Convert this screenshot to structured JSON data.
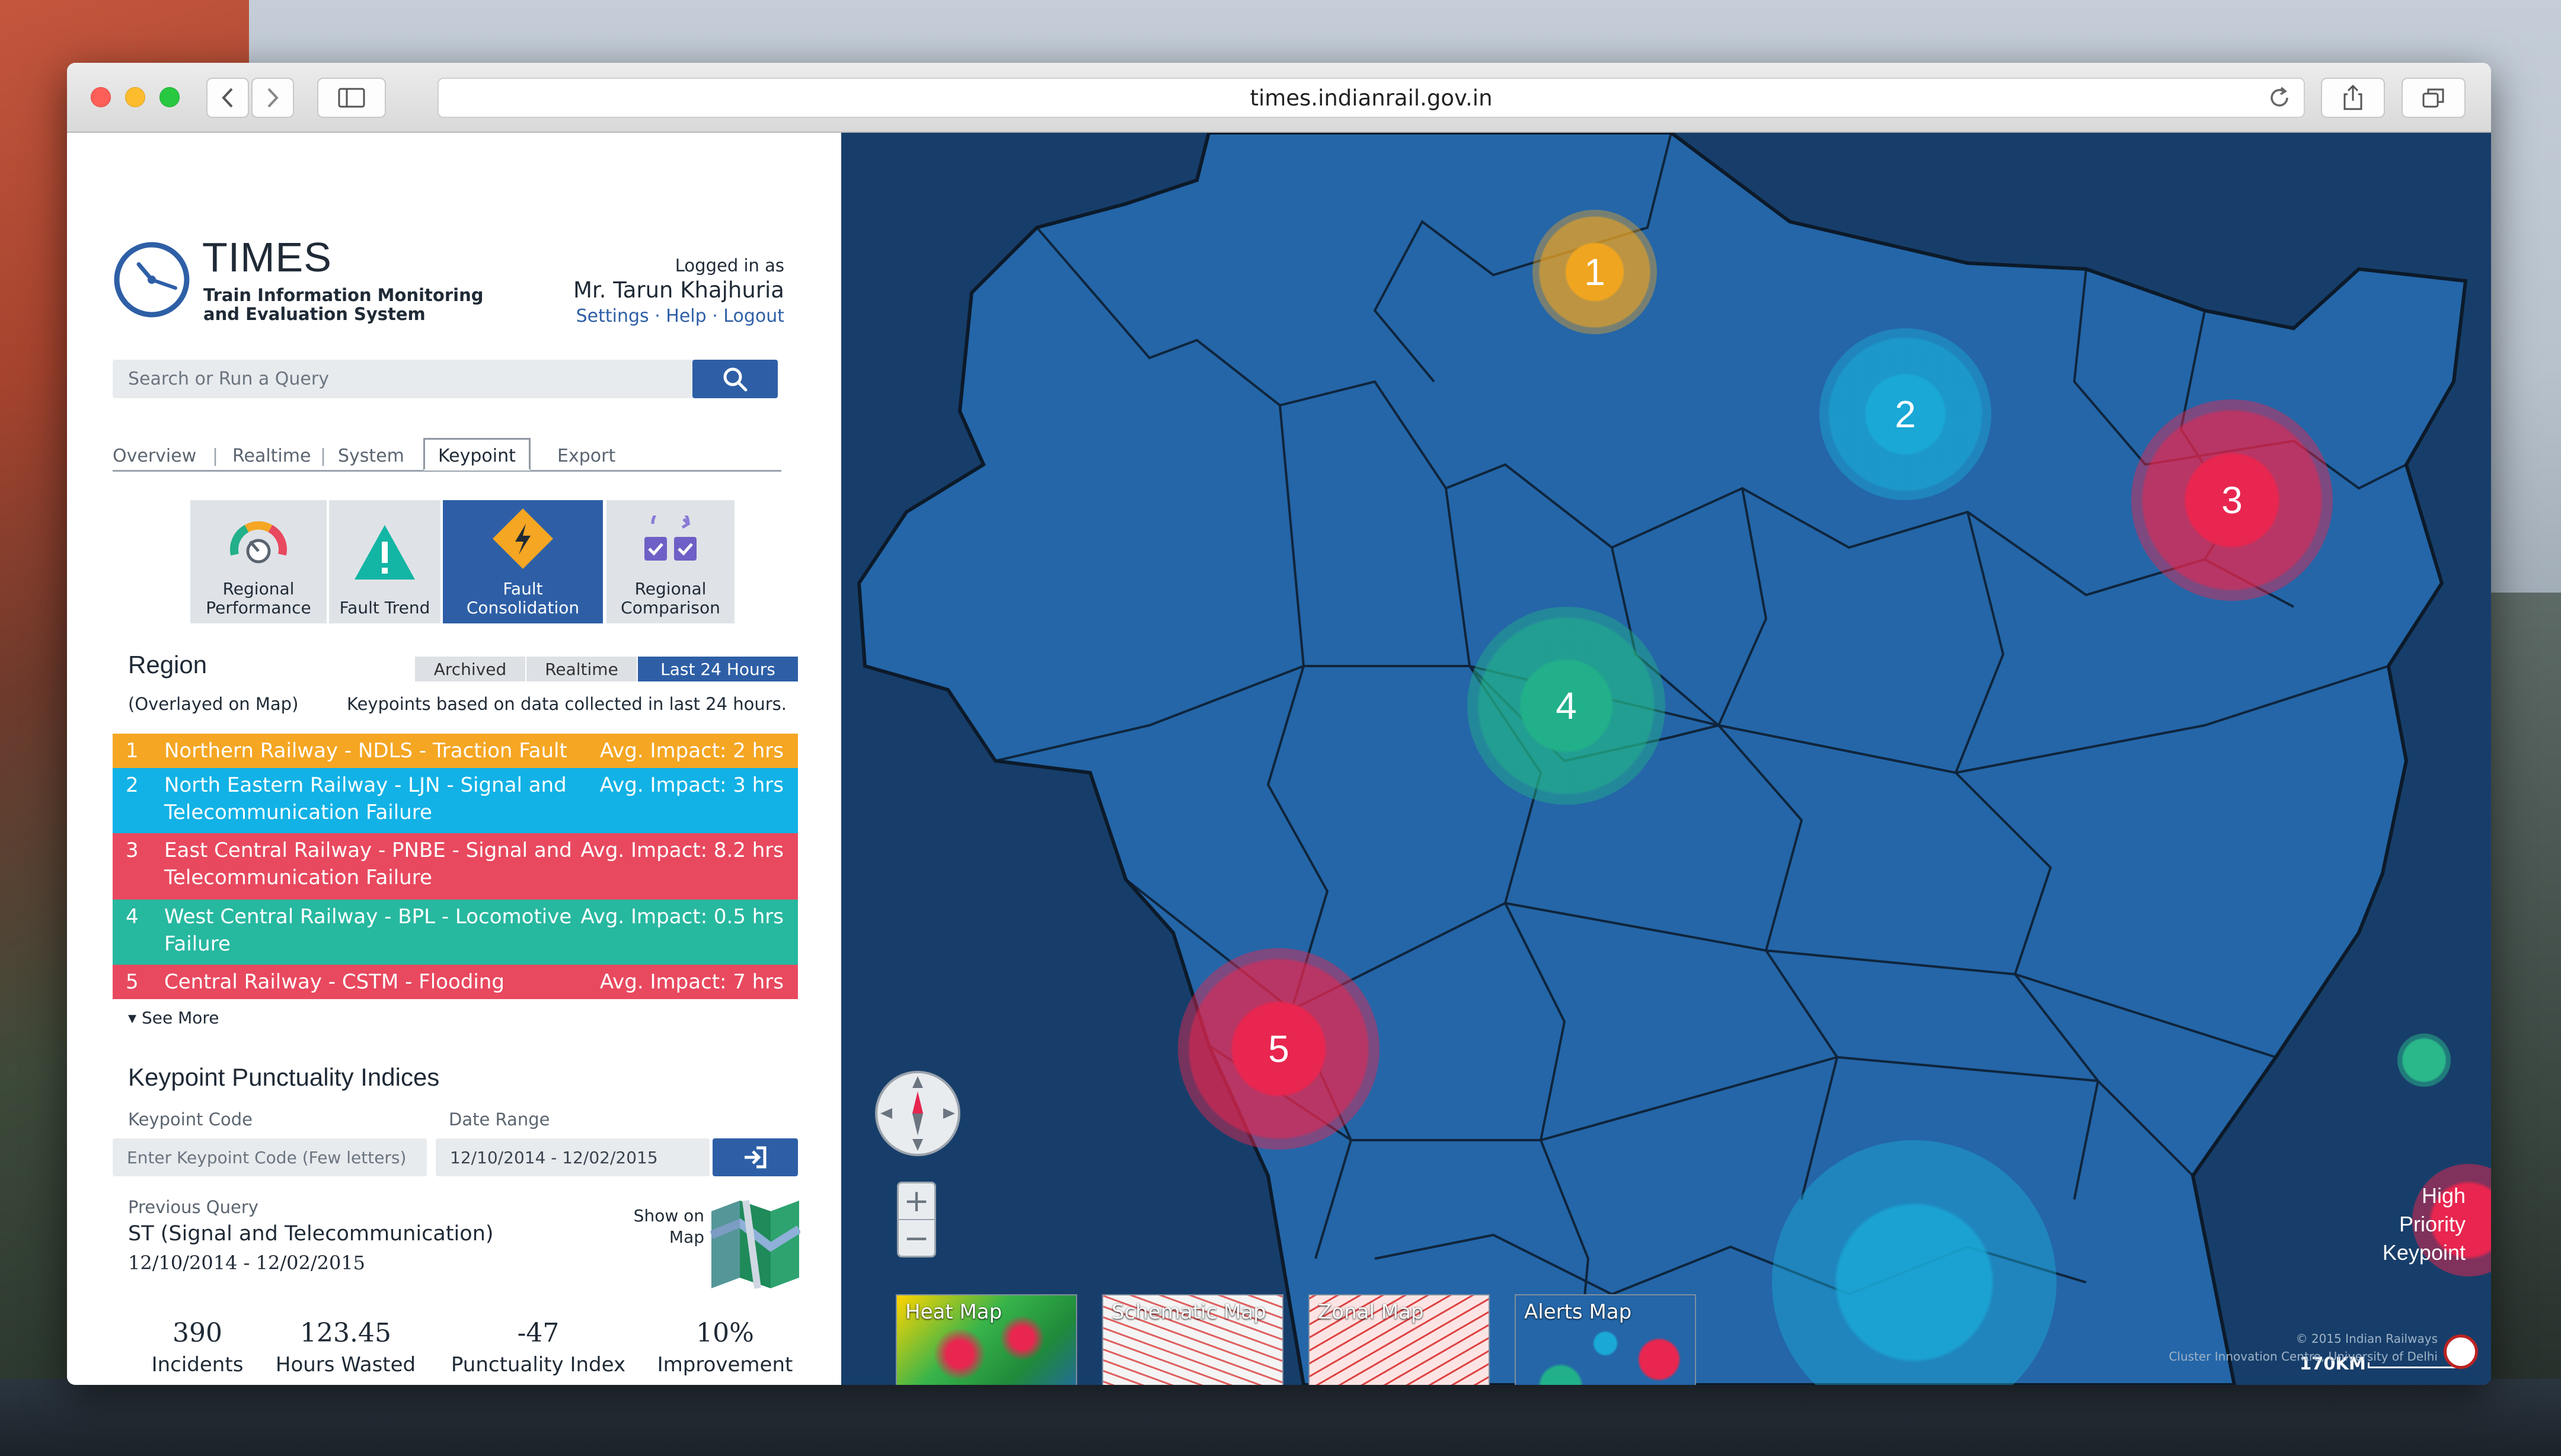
{
  "browser": {
    "url": "times.indianrail.gov.in"
  },
  "app": {
    "name": "TIMES",
    "subtitle_line1": "Train Information Monitoring",
    "subtitle_line2": "and Evaluation System",
    "logged_in_label": "Logged in as",
    "user": "Mr. Tarun Khajhuria",
    "links": [
      "Settings",
      "Help",
      "Logout"
    ]
  },
  "search": {
    "placeholder": "Search or Run a Query"
  },
  "tabs": [
    {
      "label": "Overview"
    },
    {
      "label": "Realtime"
    },
    {
      "label": "System"
    },
    {
      "label": "Keypoint",
      "selected": true
    },
    {
      "label": "Export"
    }
  ],
  "tiles": [
    {
      "label": "Regional\nPerformance",
      "icon": "gauge-icon"
    },
    {
      "label": "Fault Trend",
      "icon": "warning-icon"
    },
    {
      "label": "Fault\nConsolidation",
      "icon": "lightning-diamond-icon",
      "selected": true
    },
    {
      "label": "Regional\nComparison",
      "icon": "compare-icon"
    }
  ],
  "region": {
    "title": "Region",
    "subtitle": "(Overlayed on Map)",
    "note": "Keypoints based on data collected in last 24 hours.",
    "segments": [
      "Archived",
      "Realtime",
      "Last 24 Hours"
    ],
    "selected_segment": "Last 24 Hours",
    "items": [
      {
        "num": "1",
        "name": "Northern Railway - NDLS - Traction Fault",
        "impact": "Avg. Impact: 2 hrs",
        "color": "#f5a623"
      },
      {
        "num": "2",
        "name": "North Eastern Railway - LJN - Signal and Telecommunication Failure",
        "impact": "Avg. Impact: 3 hrs",
        "color": "#12b2e6"
      },
      {
        "num": "3",
        "name": "East Central Railway - PNBE - Signal and Telecommunication Failure",
        "impact": "Avg. Impact: 8.2 hrs",
        "color": "#e8495f"
      },
      {
        "num": "4",
        "name": "West Central Railway - BPL - Locomotive Failure",
        "impact": "Avg. Impact: 0.5 hrs",
        "color": "#27b8a0"
      },
      {
        "num": "5",
        "name": "Central Railway - CSTM - Flooding",
        "impact": "Avg. Impact: 7 hrs",
        "color": "#e8495f"
      }
    ],
    "see_more": "See More"
  },
  "kpi": {
    "title": "Keypoint Punctuality Indices",
    "code_label": "Keypoint Code",
    "code_placeholder": "Enter Keypoint Code (Few letters)",
    "date_label": "Date Range",
    "date_value": "12/10/2014 - 12/02/2015",
    "prev_label": "Previous Query",
    "prev_query": "ST (Signal and Telecommunication)",
    "prev_dates": "12/10/2014 - 12/02/2015",
    "show_on_map": "Show on Map",
    "stats": [
      {
        "value": "390",
        "label": "Incidents"
      },
      {
        "value": "123.45",
        "label": "Hours Wasted"
      },
      {
        "value": "-47",
        "label": "Punctuality Index"
      },
      {
        "value": "10%",
        "label": "Improvement"
      }
    ]
  },
  "map": {
    "keypoints": [
      {
        "num": "1",
        "color": "#f0a520"
      },
      {
        "num": "2",
        "color": "#1aa8d6"
      },
      {
        "num": "3",
        "color": "#e8264f"
      },
      {
        "num": "4",
        "color": "#22b08a"
      },
      {
        "num": "5",
        "color": "#e8264f"
      }
    ],
    "legend": {
      "label": "High Priority Keypoint"
    },
    "thumbnails": [
      "Heat Map",
      "Schematic Map",
      "Zonal Map",
      "Alerts Map"
    ],
    "scale": "170KM",
    "credit_line1": "© 2015 Indian Railways",
    "credit_line2": "Cluster Innovation Centre, University of Delhi"
  }
}
